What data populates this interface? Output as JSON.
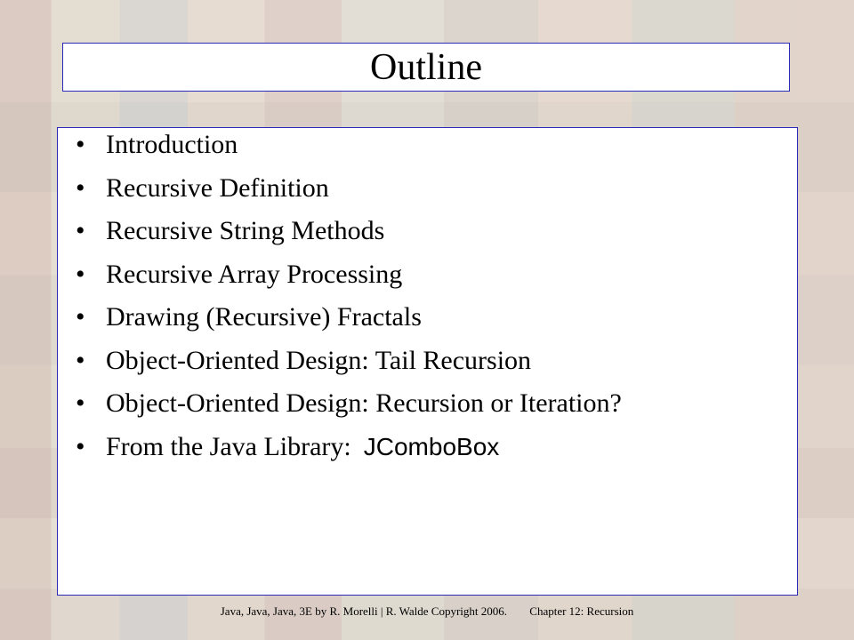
{
  "slide": {
    "title": "Outline",
    "bullets": [
      {
        "text": "Introduction"
      },
      {
        "text": "Recursive Definition"
      },
      {
        "text": "Recursive String Methods"
      },
      {
        "text": "Recursive Array Processing"
      },
      {
        "text": "Drawing (Recursive) Fractals"
      },
      {
        "text": "Object-Oriented Design: Tail Recursion"
      },
      {
        "text": "Object-Oriented Design: Recursion or Iteration?"
      },
      {
        "text": "From the Java Library:",
        "code": "JComboBox"
      }
    ],
    "bullet_glyph": "•",
    "footer": {
      "credit": "Java, Java, Java, 3E by R. Morelli | R. Walde   Copyright 2006.",
      "chapter": "Chapter 12: Recursion"
    }
  },
  "colors": {
    "frame_border": "#2b2bb8",
    "text": "#000000",
    "panel": "#ffffff"
  }
}
